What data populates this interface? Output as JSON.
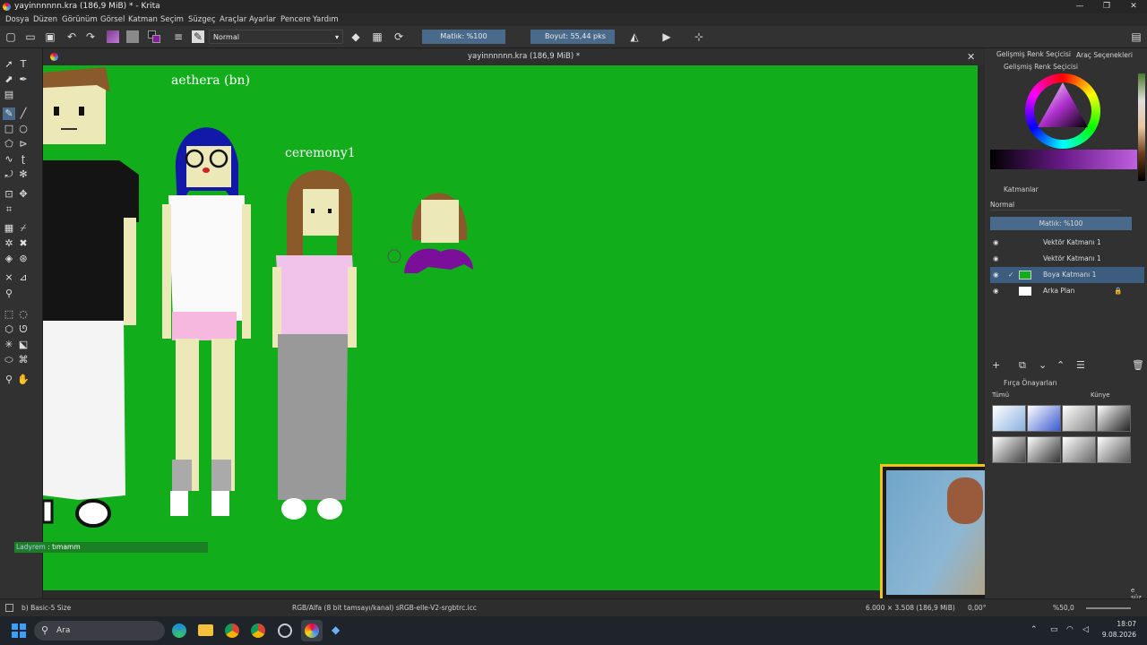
{
  "window": {
    "title": "yayinnnnnn.kra (186,9 MiB) * - Krita",
    "controls": [
      "—",
      "❐",
      "✕"
    ]
  },
  "menu": [
    "Dosya",
    "Düzen",
    "Görünüm",
    "Görsel",
    "Katman",
    "Seçim",
    "Süzgeç",
    "Araçlar",
    "Ayarlar",
    "Pencere",
    "Yardım"
  ],
  "toolbar": {
    "blend_mode": "Normal",
    "opacity": "Matlık: %100",
    "size": "Boyut: 55,44 pks"
  },
  "document": {
    "tab_title": "yayinnnnnn.kra (186,9 MiB) *",
    "labels": [
      "aethera (bn)",
      "ceremony1"
    ]
  },
  "chat": {
    "user": "Ladyrem",
    "separator": " : ",
    "message": "tımamm"
  },
  "right_panel": {
    "tabs": [
      "Gelişmiş Renk Seçicisi",
      "Araç Seçenekleri"
    ],
    "color_selector_title": "Gelişmiş Renk Seçicisi",
    "layers_title": "Katmanlar",
    "layer_blend": "Normal",
    "layer_opacity": "Matlık: %100",
    "layers": [
      {
        "name": "Vektör Katmanı 1",
        "active": false
      },
      {
        "name": "Vektör Katmanı 1",
        "active": false
      },
      {
        "name": "Boya Katmanı 1",
        "active": true
      },
      {
        "name": "Arka Plan",
        "active": false
      }
    ],
    "brush_presets_title": "Fırça Önayarları",
    "brush_filter": "Tümü",
    "brush_tag": "Künye",
    "brush_filter_label": "e süz"
  },
  "statusbar": {
    "brush": "b) Basic-5 Size",
    "color_profile": "RGB/Alfa (8 bit tamsayı/kanal)  sRGB-elle-V2-srgbtrc.icc",
    "doc_size": "6.000 × 3.508 (186,9 MiB)",
    "rotation": "0,00°",
    "zoom": "%50,0"
  },
  "taskbar": {
    "search_placeholder": "Ara",
    "time": "18:07",
    "date": "9.08.2026"
  },
  "colors": {
    "canvas_bg": "#11ad1b",
    "selection": "#3d5d80"
  }
}
